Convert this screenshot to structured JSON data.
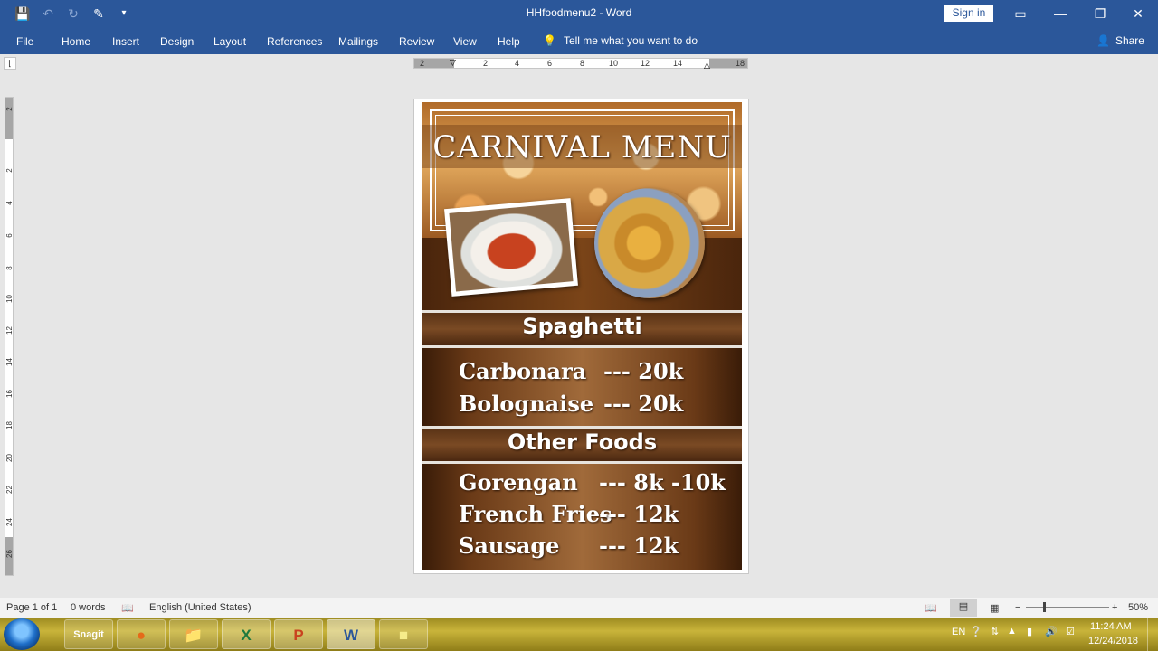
{
  "window": {
    "title": "HHfoodmenu2 - Word",
    "sign_in": "Sign in",
    "min_icon": "minimize-icon",
    "restore_icon": "restore-icon",
    "close_icon": "close-icon"
  },
  "qat": {
    "save_icon": "save-icon",
    "undo_icon": "undo-icon",
    "redo_icon": "redo-icon",
    "touch_icon": "touch-mode-icon",
    "customize_icon": "customize-icon"
  },
  "ribbon": {
    "tabs": [
      "File",
      "Home",
      "Insert",
      "Design",
      "Layout",
      "References",
      "Mailings",
      "Review",
      "View",
      "Help"
    ],
    "tell_me": "Tell me what you want to do",
    "share": "Share"
  },
  "ruler": {
    "h_labels": [
      "2",
      "2",
      "4",
      "6",
      "8",
      "10",
      "12",
      "14",
      "18"
    ],
    "v_labels": [
      "2",
      "2",
      "4",
      "6",
      "8",
      "10",
      "12",
      "14",
      "16",
      "18",
      "20",
      "22",
      "24",
      "26"
    ]
  },
  "poster": {
    "title": "CARNIVAL MENU",
    "section1": "Spaghetti",
    "section1_items": [
      {
        "name": "Carbonara",
        "price": "--- 20k"
      },
      {
        "name": "Bolognaise",
        "price": "--- 20k"
      }
    ],
    "section2": "Other Foods",
    "section2_items": [
      {
        "name": "Gorengan",
        "price": "--- 8k -10k"
      },
      {
        "name": "French Fries",
        "price": "--- 12k"
      },
      {
        "name": "Sausage",
        "price": "--- 12k"
      }
    ]
  },
  "status": {
    "page": "Page 1 of 1",
    "words": "0 words",
    "language": "English (United States)",
    "zoom": "50%"
  },
  "taskbar": {
    "apps": [
      "Snagit",
      "Firefox",
      "File Explorer",
      "Excel",
      "PowerPoint",
      "Word",
      "Sticky Notes"
    ],
    "lang": "EN",
    "time": "11:24 AM",
    "date": "12/24/2018"
  }
}
